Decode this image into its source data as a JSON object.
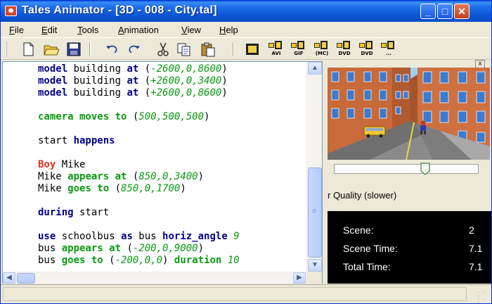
{
  "window": {
    "title": "Tales Animator - [3D - 008 - City.tal]",
    "controls": {
      "minimize": "_",
      "maximize": "□",
      "close": "✕"
    }
  },
  "menubar": {
    "items": [
      {
        "label": "File",
        "accel": "F",
        "rest": "ile"
      },
      {
        "label": "Edit",
        "accel": "E",
        "rest": "dit"
      },
      {
        "label": "Tools",
        "accel": "T",
        "rest": "ools"
      },
      {
        "label": "Animation",
        "accel": "A",
        "rest": "nimation"
      },
      {
        "label": "View",
        "accel": "V",
        "rest": "iew"
      },
      {
        "label": "Help",
        "accel": "H",
        "rest": "elp"
      }
    ]
  },
  "toolbar": {
    "buttons": [
      "new-file-icon",
      "open-folder-icon",
      "save-disk-icon",
      "undo-icon",
      "redo-icon",
      "cut-scissors-icon",
      "copy-icon",
      "paste-clipboard-icon",
      "render-film-icon"
    ],
    "export_buttons": [
      "AVI",
      "GIF",
      "(MC)",
      "DVD",
      "DVD",
      "..."
    ]
  },
  "editor": {
    "lines": [
      [
        {
          "t": "model",
          "c": "kw-blue"
        },
        {
          "t": " building "
        },
        {
          "t": "at",
          "c": "kw-blue"
        },
        {
          "t": " ("
        },
        {
          "t": "-2600,0,8600",
          "c": "num-green"
        },
        {
          "t": ")"
        }
      ],
      [
        {
          "t": "model",
          "c": "kw-blue"
        },
        {
          "t": " building "
        },
        {
          "t": "at",
          "c": "kw-blue"
        },
        {
          "t": " ("
        },
        {
          "t": "+2600,0,3400",
          "c": "num-green"
        },
        {
          "t": ")"
        }
      ],
      [
        {
          "t": "model",
          "c": "kw-blue"
        },
        {
          "t": " building "
        },
        {
          "t": "at",
          "c": "kw-blue"
        },
        {
          "t": " ("
        },
        {
          "t": "+2600,0,8600",
          "c": "num-green"
        },
        {
          "t": ")"
        }
      ],
      [],
      [
        {
          "t": "camera moves to",
          "c": "kw-green"
        },
        {
          "t": " ("
        },
        {
          "t": "500,500,500",
          "c": "num-green"
        },
        {
          "t": ")"
        }
      ],
      [],
      [
        {
          "t": "start "
        },
        {
          "t": "happens",
          "c": "kw-blue"
        }
      ],
      [],
      [
        {
          "t": "Boy",
          "c": "kw-red"
        },
        {
          "t": " Mike"
        }
      ],
      [
        {
          "t": "Mike "
        },
        {
          "t": "appears at",
          "c": "kw-green"
        },
        {
          "t": " ("
        },
        {
          "t": "850,0,3400",
          "c": "num-green"
        },
        {
          "t": ")"
        }
      ],
      [
        {
          "t": "Mike "
        },
        {
          "t": "goes to",
          "c": "kw-green"
        },
        {
          "t": " ("
        },
        {
          "t": "850,0,1700",
          "c": "num-green"
        },
        {
          "t": ")"
        }
      ],
      [],
      [
        {
          "t": "during",
          "c": "kw-blue"
        },
        {
          "t": " start"
        }
      ],
      [],
      [
        {
          "t": "use",
          "c": "kw-blue"
        },
        {
          "t": " schoolbus "
        },
        {
          "t": "as",
          "c": "kw-blue"
        },
        {
          "t": " bus "
        },
        {
          "t": "horiz_angle",
          "c": "kw-blue"
        },
        {
          "t": " 9",
          "c": "num-green"
        }
      ],
      [
        {
          "t": "bus "
        },
        {
          "t": "appears at",
          "c": "kw-green"
        },
        {
          "t": " ("
        },
        {
          "t": "-200,0,9000",
          "c": "num-green"
        },
        {
          "t": ")"
        }
      ],
      [
        {
          "t": "bus "
        },
        {
          "t": "goes to",
          "c": "kw-green"
        },
        {
          "t": " ("
        },
        {
          "t": "-200,0,0",
          "c": "num-green"
        },
        {
          "t": ") "
        },
        {
          "t": "duration",
          "c": "kw-green"
        },
        {
          "t": " 10",
          "c": "num-green"
        }
      ]
    ],
    "scrollbar": {
      "up": "▲",
      "down": "▼",
      "left": "◀",
      "right": "▶"
    }
  },
  "preview_panel": {
    "close": "x",
    "quality_label": "r Quality (slower)",
    "slider_value_fraction": 0.63,
    "stats": [
      {
        "label": "Scene:",
        "value": "2"
      },
      {
        "label": "Scene Time:",
        "value": "7.1"
      },
      {
        "label": "Total Time:",
        "value": "7.1"
      }
    ]
  },
  "colors": {
    "keyword_blue": "#00008b",
    "keyword_green": "#0a9a12",
    "keyword_red": "#e23020",
    "titlebar": "#0b55d3"
  }
}
